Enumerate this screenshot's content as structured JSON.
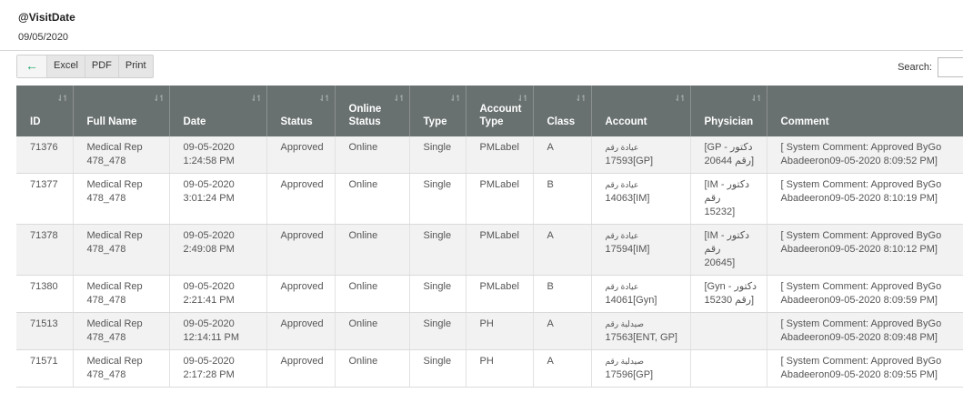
{
  "param": {
    "title": "@VisitDate",
    "value": "09/05/2020"
  },
  "toolbar": {
    "back_icon": "←",
    "excel": "Excel",
    "pdf": "PDF",
    "print": "Print"
  },
  "search": {
    "label": "Search:",
    "placeholder": ""
  },
  "table": {
    "headers": [
      "ID",
      "Full Name",
      "Date",
      "Status",
      "Online Status",
      "Type",
      "Account Type",
      "Class",
      "Account",
      "Physician",
      "Comment"
    ],
    "rows": [
      {
        "id": "71376",
        "name": "Medical Rep 478_478",
        "date": "09-05-2020",
        "time": "1:24:58 PM",
        "status": "Approved",
        "online": "Online",
        "type": "Single",
        "acctype": "PMLabel",
        "class": "A",
        "account_ar": "عيادة رقم",
        "account": "17593[GP]",
        "physician_a": "[GP - دكتور",
        "physician_b": "رقم 20644]",
        "comment_a": "[ System Comment: Approved ByGo",
        "comment_b": "Abadeeron09-05-2020 8:09:52 PM]"
      },
      {
        "id": "71377",
        "name": "Medical Rep 478_478",
        "date": "09-05-2020",
        "time": "3:01:24 PM",
        "status": "Approved",
        "online": "Online",
        "type": "Single",
        "acctype": "PMLabel",
        "class": "B",
        "account_ar": "عيادة رقم",
        "account": "14063[IM]",
        "physician_a": "[IM - دكتور رقم",
        "physician_b": "15232]",
        "comment_a": "[ System Comment: Approved ByGo",
        "comment_b": "Abadeeron09-05-2020 8:10:19 PM]"
      },
      {
        "id": "71378",
        "name": "Medical Rep 478_478",
        "date": "09-05-2020",
        "time": "2:49:08 PM",
        "status": "Approved",
        "online": "Online",
        "type": "Single",
        "acctype": "PMLabel",
        "class": "A",
        "account_ar": "عيادة رقم",
        "account": "17594[IM]",
        "physician_a": "[IM - دكتور رقم",
        "physician_b": "20645]",
        "comment_a": "[ System Comment: Approved ByGo",
        "comment_b": "Abadeeron09-05-2020 8:10:12 PM]"
      },
      {
        "id": "71380",
        "name": "Medical Rep 478_478",
        "date": "09-05-2020",
        "time": "2:21:41 PM",
        "status": "Approved",
        "online": "Online",
        "type": "Single",
        "acctype": "PMLabel",
        "class": "B",
        "account_ar": "عيادة رقم",
        "account": "14061[Gyn]",
        "physician_a": "[Gyn - دكتور",
        "physician_b": "رقم 15230]",
        "comment_a": "[ System Comment: Approved ByGo",
        "comment_b": "Abadeeron09-05-2020 8:09:59 PM]"
      },
      {
        "id": "71513",
        "name": "Medical Rep 478_478",
        "date": "09-05-2020",
        "time": "12:14:11 PM",
        "status": "Approved",
        "online": "Online",
        "type": "Single",
        "acctype": "PH",
        "class": "A",
        "account_ar": "صيدلية رقم",
        "account": "17563[ENT, GP]",
        "physician_a": "",
        "physician_b": "",
        "comment_a": "[ System Comment: Approved ByGo",
        "comment_b": "Abadeeron09-05-2020 8:09:48 PM]"
      },
      {
        "id": "71571",
        "name": "Medical Rep 478_478",
        "date": "09-05-2020",
        "time": "2:17:28 PM",
        "status": "Approved",
        "online": "Online",
        "type": "Single",
        "acctype": "PH",
        "class": "A",
        "account_ar": "صيدلية رقم",
        "account": "17596[GP]",
        "physician_a": "",
        "physician_b": "",
        "comment_a": "[ System Comment: Approved ByGo",
        "comment_b": "Abadeeron09-05-2020 8:09:55 PM]"
      }
    ]
  },
  "colors": {
    "header_bg": "#697170",
    "row_alt": "#f2f2f2",
    "accent_green": "#1aa56a"
  }
}
